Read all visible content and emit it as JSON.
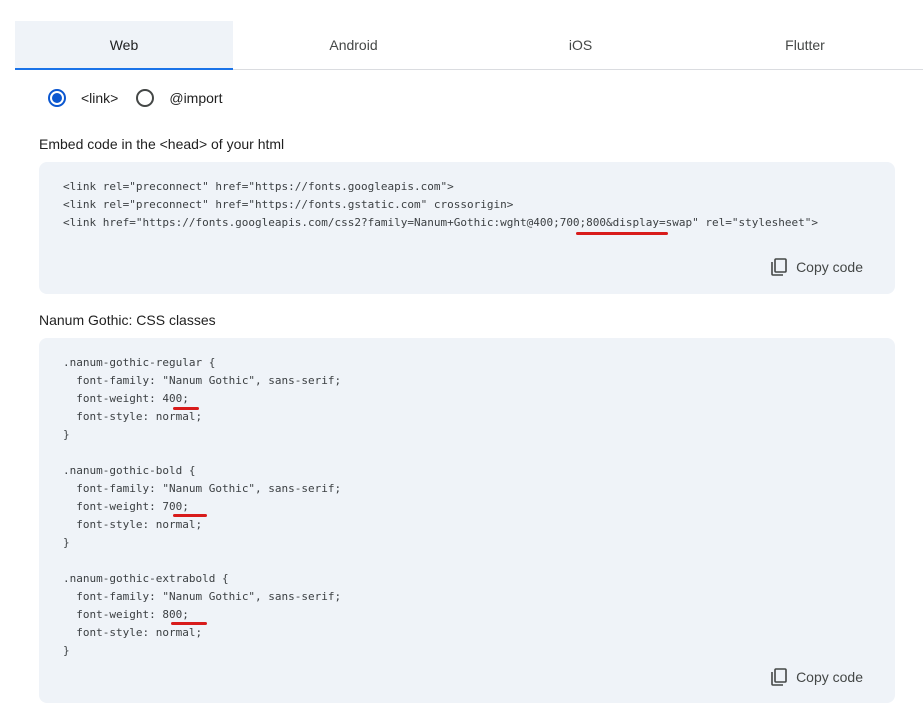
{
  "tabs": [
    {
      "label": "Web",
      "active": true
    },
    {
      "label": "Android",
      "active": false
    },
    {
      "label": "iOS",
      "active": false
    },
    {
      "label": "Flutter",
      "active": false
    }
  ],
  "embed_type": {
    "options": [
      {
        "label": "<link>",
        "checked": true
      },
      {
        "label": "@import",
        "checked": false
      }
    ]
  },
  "embed_section": {
    "title": "Embed code in the <head> of your html",
    "code": "<link rel=\"preconnect\" href=\"https://fonts.googleapis.com\">\n<link rel=\"preconnect\" href=\"https://fonts.gstatic.com\" crossorigin>\n<link href=\"https://fonts.googleapis.com/css2?family=Nanum+Gothic:wght@400;700;800&display=swap\" rel=\"stylesheet\">",
    "copy_label": "Copy code"
  },
  "css_section": {
    "title": "Nanum Gothic: CSS classes",
    "code": ".nanum-gothic-regular {\n  font-family: \"Nanum Gothic\", sans-serif;\n  font-weight: 400;\n  font-style: normal;\n}\n\n.nanum-gothic-bold {\n  font-family: \"Nanum Gothic\", sans-serif;\n  font-weight: 700;\n  font-style: normal;\n}\n\n.nanum-gothic-extrabold {\n  font-family: \"Nanum Gothic\", sans-serif;\n  font-weight: 800;\n  font-style: normal;\n}",
    "copy_label": "Copy code"
  },
  "colors": {
    "accent": "#0b57d0",
    "tab_active_bg": "#eff3f8",
    "code_bg": "#eff3f8",
    "annotation": "#d81b1b"
  },
  "icons": {
    "copy": "copy-icon"
  }
}
